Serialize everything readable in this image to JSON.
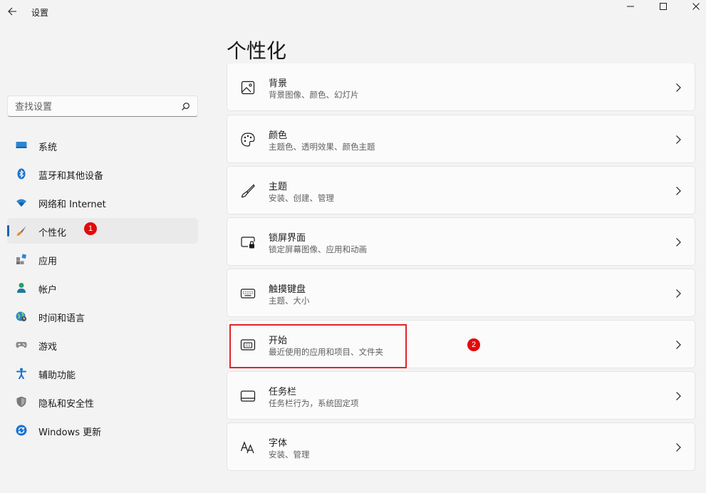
{
  "window": {
    "title": "设置"
  },
  "search": {
    "placeholder": "查找设置"
  },
  "sidebar": {
    "items": [
      {
        "label": "系统",
        "icon": "system-icon"
      },
      {
        "label": "蓝牙和其他设备",
        "icon": "bluetooth-icon"
      },
      {
        "label": "网络和 Internet",
        "icon": "wifi-icon"
      },
      {
        "label": "个性化",
        "icon": "brush-icon",
        "active": true
      },
      {
        "label": "应用",
        "icon": "apps-icon"
      },
      {
        "label": "帐户",
        "icon": "account-icon"
      },
      {
        "label": "时间和语言",
        "icon": "globe-clock-icon"
      },
      {
        "label": "游戏",
        "icon": "gamepad-icon"
      },
      {
        "label": "辅助功能",
        "icon": "accessibility-icon"
      },
      {
        "label": "隐私和安全性",
        "icon": "shield-icon"
      },
      {
        "label": "Windows 更新",
        "icon": "update-icon"
      }
    ]
  },
  "annotations": {
    "badge1": "1",
    "badge2": "2"
  },
  "main": {
    "title": "个性化",
    "cards": [
      {
        "title": "背景",
        "subtitle": "背景图像、颜色、幻灯片",
        "icon": "picture-icon"
      },
      {
        "title": "颜色",
        "subtitle": "主题色、透明效果、颜色主题",
        "icon": "palette-icon"
      },
      {
        "title": "主题",
        "subtitle": "安装、创建、管理",
        "icon": "brush-icon"
      },
      {
        "title": "锁屏界面",
        "subtitle": "锁定屏幕图像、应用和动画",
        "icon": "lock-screen-icon"
      },
      {
        "title": "触摸键盘",
        "subtitle": "主题、大小",
        "icon": "keyboard-icon"
      },
      {
        "title": "开始",
        "subtitle": "最近使用的应用和项目、文件夹",
        "icon": "start-menu-icon"
      },
      {
        "title": "任务栏",
        "subtitle": "任务栏行为，系统固定项",
        "icon": "taskbar-icon"
      },
      {
        "title": "字体",
        "subtitle": "安装、管理",
        "icon": "font-icon"
      }
    ]
  },
  "colors": {
    "accent": "#1a64b4",
    "annotation_red": "#e30a0a",
    "highlight_border": "#e0242a"
  }
}
